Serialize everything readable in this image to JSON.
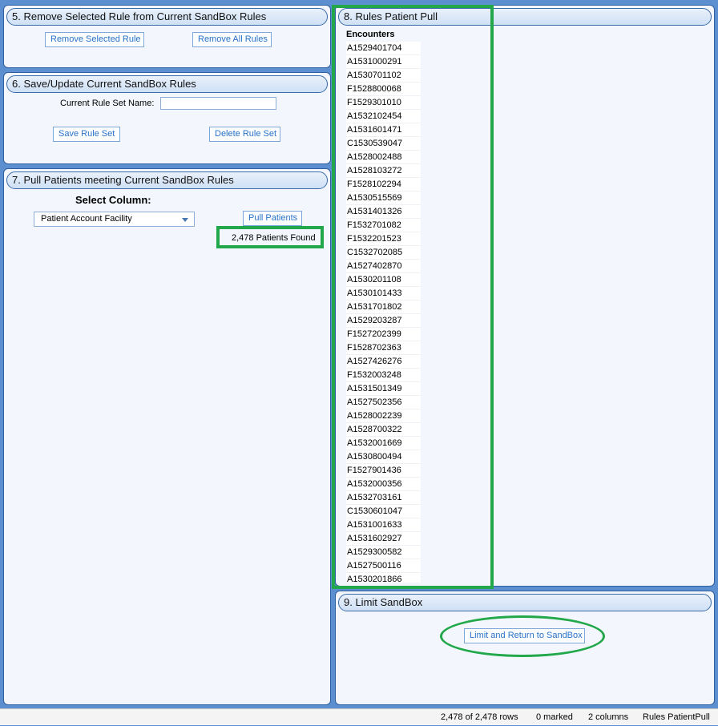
{
  "panels": {
    "remove": {
      "title": "5. Remove Selected Rule from Current SandBox Rules",
      "remove_selected_label": "Remove Selected Rule",
      "remove_all_label": "Remove All Rules"
    },
    "save": {
      "title": "6. Save/Update Current SandBox Rules",
      "rule_set_name_label": "Current Rule Set Name:",
      "rule_set_name_value": "",
      "save_label": "Save Rule Set",
      "delete_label": "Delete Rule Set"
    },
    "pull": {
      "title": "7. Pull Patients meeting Current SandBox Rules",
      "select_column_label": "Select Column:",
      "column_selected": "Patient Account Facility",
      "pull_label": "Pull Patients",
      "result_text": "2,478 Patients Found"
    },
    "rules_pull": {
      "title": "8. Rules Patient Pull",
      "column_header": "Encounters",
      "encounters": [
        "A1529401704",
        "A1531000291",
        "A1530701102",
        "F1528800068",
        "F1529301010",
        "A1532102454",
        "A1531601471",
        "C1530539047",
        "A1528002488",
        "A1528103272",
        "F1528102294",
        "A1530515569",
        "A1531401326",
        "F1532701082",
        "F1532201523",
        "C1532702085",
        "A1527402870",
        "A1530201108",
        "A1530101433",
        "A1531701802",
        "A1529203287",
        "F1527202399",
        "F1528702363",
        "A1527426276",
        "F1532003248",
        "A1531501349",
        "A1527502356",
        "A1528002239",
        "A1528700322",
        "A1532001669",
        "A1530800494",
        "F1527901436",
        "A1532000356",
        "A1532703161",
        "C1530601047",
        "A1531001633",
        "A1531602927",
        "A1529300582",
        "A1527500116",
        "A1530201866"
      ]
    },
    "limit": {
      "title": "9. Limit SandBox",
      "limit_label": "Limit and Return to SandBox"
    }
  },
  "status": {
    "rows": "2,478 of 2,478 rows",
    "marked": "0 marked",
    "columns": "2 columns",
    "view": "Rules PatientPull"
  },
  "colors": {
    "highlight": "#22a84a",
    "button_text": "#2a72c8",
    "background": "#5b8fd0"
  }
}
